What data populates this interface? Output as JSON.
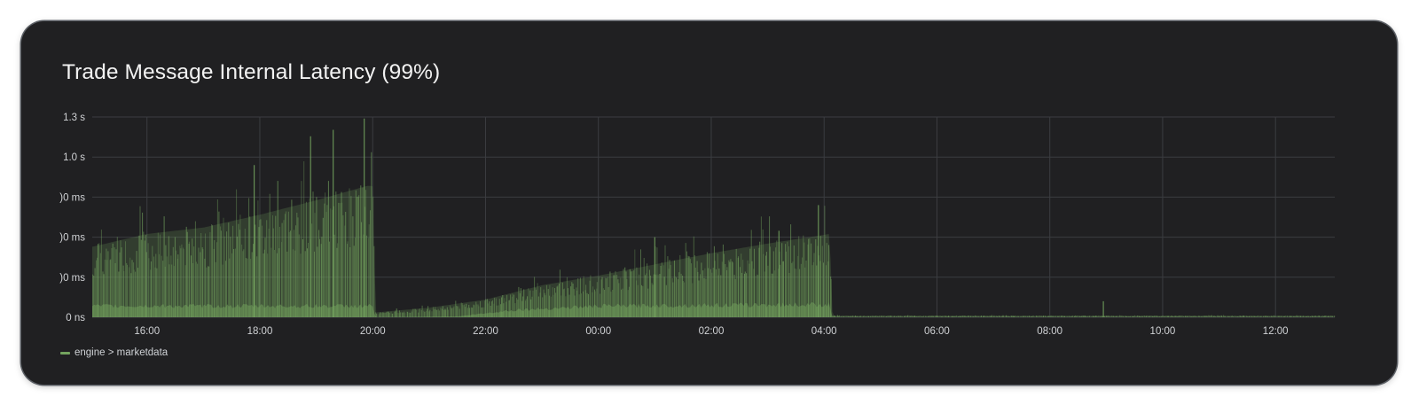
{
  "panel": {
    "title": "Trade Message Internal Latency (99%)"
  },
  "chart_data": {
    "type": "area",
    "title": "Trade Message Internal Latency (99%)",
    "xlabel": "",
    "ylabel": "",
    "y_unit": "ms",
    "ylim": [
      0,
      1250
    ],
    "y_ticks": [
      {
        "value": 0,
        "label": "0 ns"
      },
      {
        "value": 250,
        "label": ")0 ms"
      },
      {
        "value": 500,
        "label": ")0 ms"
      },
      {
        "value": 750,
        "label": ")0 ms"
      },
      {
        "value": 1000,
        "label": "1.0 s"
      },
      {
        "value": 1250,
        "label": "1.3 s"
      }
    ],
    "x_unit": "hours since 16:00 (day 1)",
    "xlim": [
      -0.97,
      21.05
    ],
    "x_ticks": [
      {
        "value": 0,
        "label": "16:00"
      },
      {
        "value": 2,
        "label": "18:00"
      },
      {
        "value": 4,
        "label": "20:00"
      },
      {
        "value": 6,
        "label": "22:00"
      },
      {
        "value": 8,
        "label": "00:00"
      },
      {
        "value": 10,
        "label": "02:00"
      },
      {
        "value": 12,
        "label": "04:00"
      },
      {
        "value": 14,
        "label": "06:00"
      },
      {
        "value": 16,
        "label": "08:00"
      },
      {
        "value": 18,
        "label": "10:00"
      },
      {
        "value": 20,
        "label": "12:00"
      }
    ],
    "grid": true,
    "legend_position": "bottom-left",
    "series": [
      {
        "name": "engine > marketdata",
        "color": "#73a35e",
        "envelope": [
          {
            "t": -0.97,
            "v": 440
          },
          {
            "t": 0,
            "v": 520
          },
          {
            "t": 1,
            "v": 560
          },
          {
            "t": 2,
            "v": 640
          },
          {
            "t": 3,
            "v": 730
          },
          {
            "t": 3.9,
            "v": 820
          },
          {
            "t": 4.0,
            "v": 820
          },
          {
            "t": 4.05,
            "v": 30
          },
          {
            "t": 5,
            "v": 60
          },
          {
            "t": 6,
            "v": 110
          },
          {
            "t": 7,
            "v": 200
          },
          {
            "t": 8,
            "v": 260
          },
          {
            "t": 9,
            "v": 330
          },
          {
            "t": 10,
            "v": 400
          },
          {
            "t": 11,
            "v": 460
          },
          {
            "t": 12.1,
            "v": 520
          },
          {
            "t": 12.15,
            "v": 10
          },
          {
            "t": 21.05,
            "v": 10
          }
        ],
        "baseline_band": [
          {
            "t": -0.97,
            "v": 70
          },
          {
            "t": 4.0,
            "v": 70
          },
          {
            "t": 4.05,
            "v": 0
          },
          {
            "t": 5.5,
            "v": 5
          },
          {
            "t": 6.5,
            "v": 45
          },
          {
            "t": 8,
            "v": 70
          },
          {
            "t": 12.1,
            "v": 80
          },
          {
            "t": 12.15,
            "v": 0
          },
          {
            "t": 21.05,
            "v": 0
          }
        ],
        "spikes": [
          {
            "t": 1.9,
            "v": 950
          },
          {
            "t": 2.9,
            "v": 1130
          },
          {
            "t": 3.3,
            "v": 1170
          },
          {
            "t": 3.85,
            "v": 1240
          },
          {
            "t": 9.0,
            "v": 500
          },
          {
            "t": 11.2,
            "v": 540
          },
          {
            "t": 11.9,
            "v": 700
          },
          {
            "t": 16.95,
            "v": 100
          }
        ]
      }
    ]
  }
}
